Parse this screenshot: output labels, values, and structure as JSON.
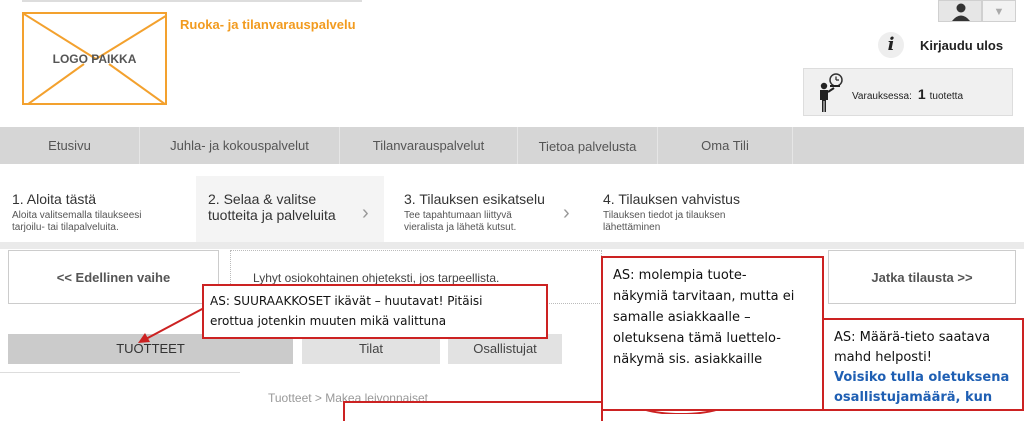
{
  "header": {
    "logo_text": "LOGO PAIKKA",
    "service_title": "Ruoka- ja tilanvarauspalvelu",
    "logout_label": "Kirjaudu ulos",
    "cart_label": "Varauksessa:",
    "cart_count": "1",
    "cart_unit": "tuotetta"
  },
  "nav": {
    "items": [
      "Etusivu",
      "Juhla- ja kokouspalvelut",
      "Tilanvarauspalvelut",
      "Tietoa palvelusta",
      "Oma Tili"
    ]
  },
  "steps": [
    {
      "title": "1. Aloita tästä",
      "sub1": "Aloita valitsemalla tilaukseesi",
      "sub2": "tarjoilu- tai tilapalveluita."
    },
    {
      "title1": "2. Selaa & valitse",
      "title2": "tuotteita ja palveluita"
    },
    {
      "title": "3. Tilauksen esikatselu",
      "sub1": "Tee tapahtumaan liittyvä",
      "sub2": "vieralista ja lähetä kutsut."
    },
    {
      "title": "4. Tilauksen vahvistus",
      "sub1": "Tilauksen tiedot ja tilauksen",
      "sub2": "lähettäminen"
    }
  ],
  "actions": {
    "prev": "<< Edellinen vaihe",
    "help": "Lyhyt osiokohtainen ohjeteksti, jos tarpeellista.",
    "next": "Jatka tilausta >>"
  },
  "tabs": [
    "TUOTTEET",
    "Tilat",
    "Osallistujat"
  ],
  "breadcrumb": "Tuotteet > Makea leivonnaiset",
  "annotations": {
    "note1_l1": "AS: SUURAAKKOSET ikävät – huutavat! Pitäisi",
    "note1_l2": "erottua jotenkin  muuten mikä valittuna",
    "note2_l1": "AS: molempia tuote-",
    "note2_l2": "näkymiä tarvitaan, mutta ei",
    "note2_l3": "samalle asiakkaalle –",
    "note2_l4": "oletuksena tämä luettelo-",
    "note2_l5": "näkymä sis. asiakkaille",
    "note3_l1": "AS: Määrä-tieto saatava",
    "note3_l2": "mahd helposti!",
    "note3_l3": "Voisiko tulla oletuksena",
    "note3_l4": "osallistujamäärä, kun"
  },
  "colors": {
    "accent": "#f29b1f",
    "annotation_red": "#cc2222",
    "nav_bg": "#d6d6d6"
  },
  "icons": [
    "user-icon",
    "info-icon",
    "waiter-clock-icon",
    "grid-view-icon",
    "list-view-icon"
  ]
}
